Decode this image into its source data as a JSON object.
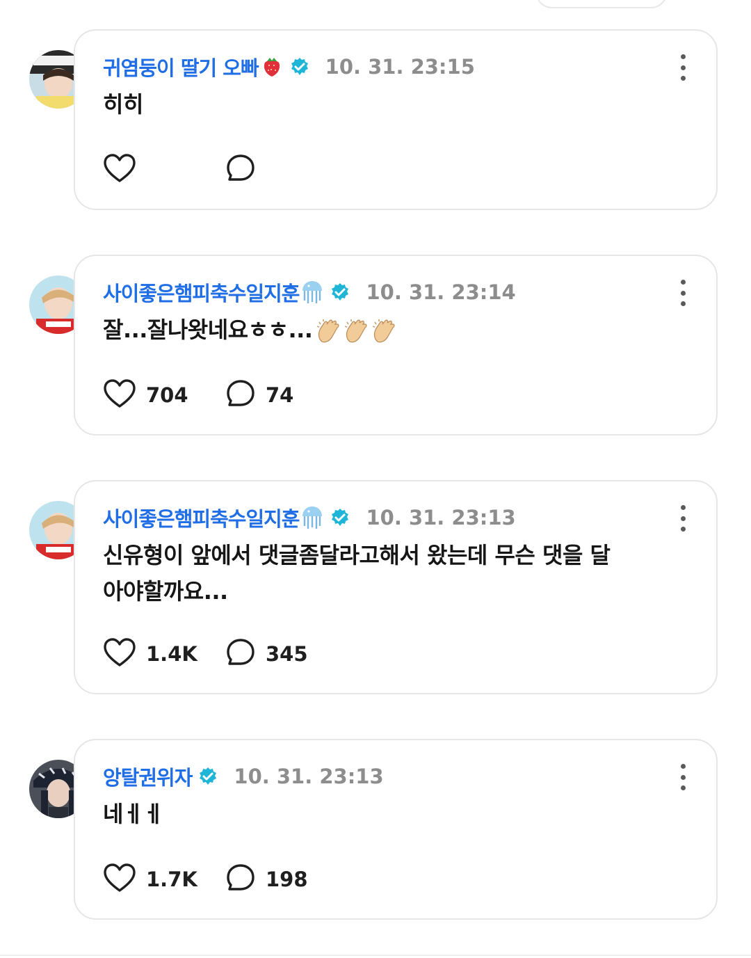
{
  "comments": [
    {
      "username": "귀염둥이 딸기 오빠",
      "name_emoji": "strawberry-emoji",
      "verified": true,
      "timestamp": "10. 31. 23:15",
      "text": "히히",
      "likes": "",
      "replies": ""
    },
    {
      "username": "사이좋은햄피축수일지훈",
      "name_emoji": "jellyfish-emoji",
      "verified": true,
      "timestamp": "10. 31. 23:14",
      "text": "잘...잘나왓네요ㅎㅎ...",
      "text_emoji": "clapping-hands-emoji x3",
      "likes": "704",
      "replies": "74"
    },
    {
      "username": "사이좋은햄피축수일지훈",
      "name_emoji": "jellyfish-emoji",
      "verified": true,
      "timestamp": "10. 31. 23:13",
      "text": "신유형이 앞에서 댓글좀달라고해서 왔는데 무슨 댓을 달아야할까요...",
      "likes": "1.4K",
      "replies": "345"
    },
    {
      "username": "앙탈권위자",
      "verified": true,
      "timestamp": "10. 31. 23:13",
      "text": "네ㅔㅔ",
      "likes": "1.7K",
      "replies": "198"
    }
  ],
  "colors": {
    "username": "#1f6ee6",
    "verified_badge": "#1fb5d6",
    "timestamp": "#8d8d8d",
    "card_border": "#e6e6e6"
  },
  "icons": {
    "like": "heart-outline-icon",
    "reply": "speech-bubble-icon",
    "more": "kebab-menu-icon"
  }
}
